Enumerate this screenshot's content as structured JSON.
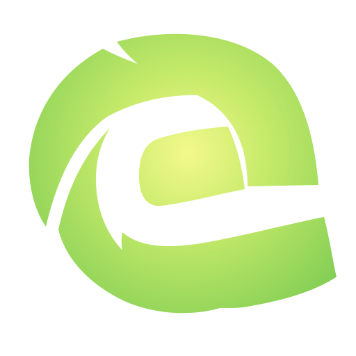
{
  "logo": {
    "name": "green-e-logo",
    "colors": {
      "background": "#ffffff",
      "glow_center": "#f3f98c",
      "glow_mid": "#c6ea6a",
      "edge_green": "#7acb52",
      "separator": "#ffffff"
    }
  }
}
